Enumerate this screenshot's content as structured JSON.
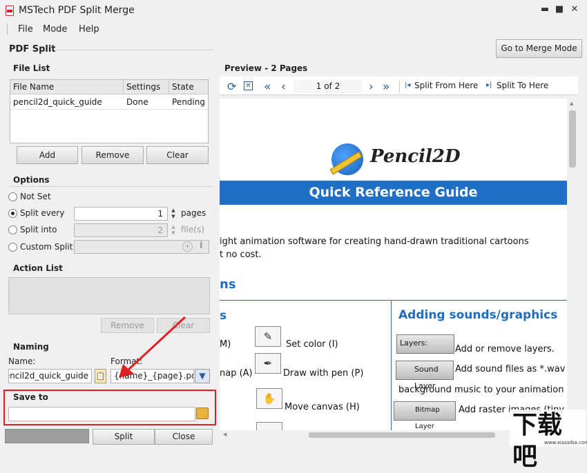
{
  "window": {
    "title": "MSTech PDF Split Merge",
    "minimize": "▬",
    "maximize": "■",
    "close": "✕"
  },
  "menu": [
    "File",
    "Mode",
    "Help"
  ],
  "header": {
    "section": "PDF Split",
    "merge_button": "Go to Merge Mode"
  },
  "file_list": {
    "title": "File List",
    "columns": [
      "File Name",
      "Settings",
      "State"
    ],
    "rows": [
      [
        "pencil2d_quick_guide",
        "Done",
        "Pending"
      ]
    ],
    "buttons": {
      "add": "Add",
      "remove": "Remove",
      "clear": "Clear"
    }
  },
  "options": {
    "title": "Options",
    "not_set": "Not Set",
    "split_every": "Split every",
    "split_every_value": "1",
    "split_every_unit": "pages",
    "split_into": "Split into",
    "split_into_value": "2",
    "split_into_unit": "file(s)",
    "custom_split": "Custom Split",
    "selected": "split_every"
  },
  "action_list": {
    "title": "Action List",
    "remove": "Remove",
    "clear": "Clear"
  },
  "naming": {
    "title": "Naming",
    "name_label": "Name:",
    "name_value": "pencil2d_quick_guide",
    "format_label": "Format:",
    "format_value": "{name}_{page}.pdf"
  },
  "save_to": {
    "title": "Save to",
    "path": ""
  },
  "bottom": {
    "split": "Split",
    "close": "Close"
  },
  "preview": {
    "title": "Preview - 2 Pages",
    "page_indicator": "1 of 2",
    "split_from": "Split From Here",
    "split_to": "Split To Here"
  },
  "document": {
    "logo_text": "Pencil2D",
    "banner": "Quick Reference Guide",
    "intro_line1": "ight animation software for creating hand-drawn traditional cartoons",
    "intro_line2": "t no cost.",
    "heading_cut": "ns",
    "left_col_heading_cut": "s",
    "right_col_heading": "Adding sounds/graphics",
    "row1_left": "M)",
    "row1_tool": "Set color (I)",
    "row2_left": "nap (A)",
    "row2_tool": "Draw with pen (P)",
    "row3_tool": "Move canvas (H)",
    "layers_btn": "Layers:",
    "layers_text": "Add or remove layers.",
    "sound_btn": "Sound Layer",
    "sound_text": "Add sound files as *.wav or",
    "sound_text2": "background music to your animation (Ct",
    "bitmap_btn": "Bitmap Layer",
    "bitmap_text": "Add raster images (tiny or"
  },
  "watermark": {
    "text": "下载吧",
    "url": "www.xiazaiba.com"
  },
  "colors": {
    "accent_blue": "#1f6fc6",
    "highlight_red": "#e02020"
  }
}
